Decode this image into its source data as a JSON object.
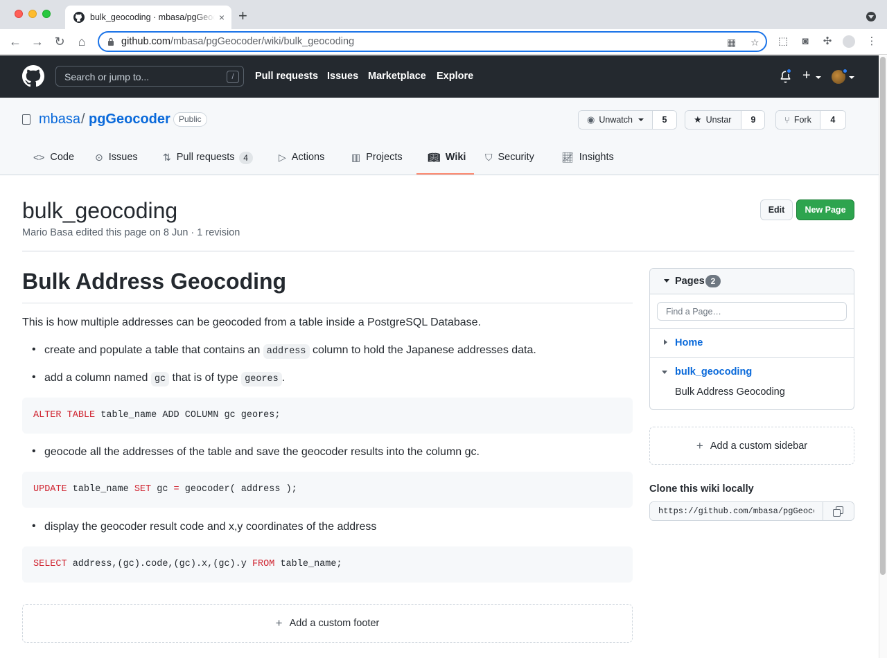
{
  "browser": {
    "tab_title": "bulk_geocoding · mbasa/pgGeocoder",
    "tab_close": "×",
    "new_tab": "+",
    "url_host": "github.com",
    "url_path": "/mbasa/pgGeocoder/wiki/bulk_geocoding"
  },
  "gh_header": {
    "search_placeholder": "Search or jump to...",
    "search_shortcut": "/",
    "nav": [
      "Pull requests",
      "Issues",
      "Marketplace",
      "Explore"
    ],
    "plus_label": "+"
  },
  "repo": {
    "owner": "mbasa",
    "separator": "/",
    "name": "pgGeocoder",
    "visibility": "Public",
    "watch_label": "Unwatch",
    "watch_count": "5",
    "star_label": "Unstar",
    "star_count": "9",
    "fork_label": "Fork",
    "fork_count": "4",
    "tabs": [
      {
        "label": "Code"
      },
      {
        "label": "Issues"
      },
      {
        "label": "Pull requests",
        "count": "4"
      },
      {
        "label": "Actions"
      },
      {
        "label": "Projects"
      },
      {
        "label": "Wiki"
      },
      {
        "label": "Security"
      },
      {
        "label": "Insights"
      }
    ]
  },
  "page": {
    "title": "bulk_geocoding",
    "meta": "Mario Basa edited this page on 8 Jun · 1 revision",
    "edit_label": "Edit",
    "new_page_label": "New Page"
  },
  "content": {
    "h1": "Bulk Address Geocoding",
    "intro": "This is how multiple addresses can be geocoded from a table inside a PostgreSQL Database.",
    "li1_pre": "create and populate a table that contains an ",
    "li1_code": "address",
    "li1_post": " column to hold the Japanese addresses data.",
    "li2_pre": "add a column named ",
    "li2_code1": "gc",
    "li2_mid": " that is of type ",
    "li2_code2": "geores",
    "li2_post": ".",
    "code1_kw1": "ALTER",
    "code1_kw2": "TABLE",
    "code1_rest": " table_name ADD COLUMN gc geores;",
    "li3": "geocode all the addresses of the table and save the geocoder results into the column gc.",
    "code2_kw1": "UPDATE",
    "code2_a": " table_name ",
    "code2_kw2": "SET",
    "code2_b": " gc ",
    "code2_eq": "=",
    "code2_c": " geocoder( address );",
    "li4": "display the geocoder result code and x,y coordinates of the address",
    "code3_kw1": "SELECT",
    "code3_a": " address,(gc).code,(gc).x,(gc).y ",
    "code3_kw2": "FROM",
    "code3_b": " table_name;",
    "footer_label": "Add a custom footer"
  },
  "sidebar": {
    "pages_label": "Pages",
    "pages_count": "2",
    "find_placeholder": "Find a Page…",
    "items": [
      {
        "label": "Home"
      },
      {
        "label": "bulk_geocoding",
        "sub": "Bulk Address Geocoding"
      }
    ],
    "custom_sidebar_label": "Add a custom sidebar",
    "clone_title": "Clone this wiki locally",
    "clone_url": "https://github.com/mbasa/pgGeocoder.wiki.git"
  },
  "colors": {
    "header_bg": "#24292f",
    "link": "#0969da",
    "primary_button": "#2da44e",
    "active_tab_underline": "#fd8c73",
    "code_keyword": "#cf222e"
  }
}
